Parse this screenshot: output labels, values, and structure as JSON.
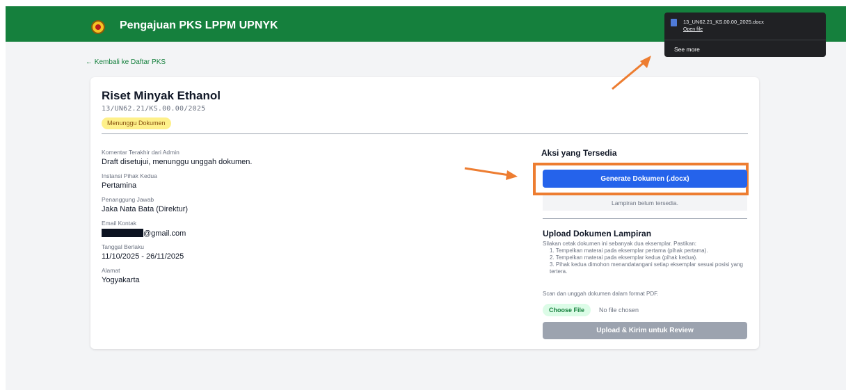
{
  "header": {
    "title": "Pengajuan PKS LPPM UPNYK"
  },
  "nav": {
    "back_link": "← Kembali ke Daftar PKS"
  },
  "pks": {
    "title": "Riset Minyak Ethanol",
    "number": "13/UN62.21/KS.00.00/2025",
    "status": "Menunggu Dokumen"
  },
  "details": [
    {
      "label": "Komentar Terakhir dari Admin",
      "value": "Draft disetujui, menunggu unggah dokumen."
    },
    {
      "label": "Instansi Pihak Kedua",
      "value": "Pertamina"
    },
    {
      "label": "Penanggung Jawab",
      "value": "Jaka Nata Bata (Direktur)"
    },
    {
      "label": "Email Kontak",
      "value": "@gmail.com"
    },
    {
      "label": "Tanggal Berlaku",
      "value": "11/10/2025 - 26/11/2025"
    },
    {
      "label": "Alamat",
      "value": "Yogyakarta"
    }
  ],
  "actions": {
    "title": "Aksi yang Tersedia",
    "generate_label": "Generate Dokumen (.docx)",
    "attachment_status": "Lampiran belum tersedia."
  },
  "upload": {
    "title": "Upload Dokumen Lampiran",
    "description": "Silakan cetak dokumen ini sebanyak dua eksemplar. Pastikan:",
    "steps": [
      "1. Tempelkan materai pada eksemplar pertama (pihak pertama).",
      "2. Tempelkan materai pada eksemplar kedua (pihak kedua).",
      "3. Pihak kedua dimohon menandatangani setiap eksemplar sesuai posisi yang tertera."
    ],
    "scan_note": "Scan dan unggah dokumen dalam format PDF.",
    "choose_file_label": "Choose File",
    "no_file_label": "No file chosen",
    "submit_label": "Upload & Kirim untuk Review"
  },
  "download_popup": {
    "filename": "13_UN62.21_KS.00.00_2025.docx",
    "open_label": "Open file",
    "see_more_label": "See more"
  },
  "colors": {
    "header_green": "#15803d",
    "primary_blue": "#2563eb",
    "annotation_orange": "#ed7d31",
    "badge_yellow": "#fef08a"
  }
}
